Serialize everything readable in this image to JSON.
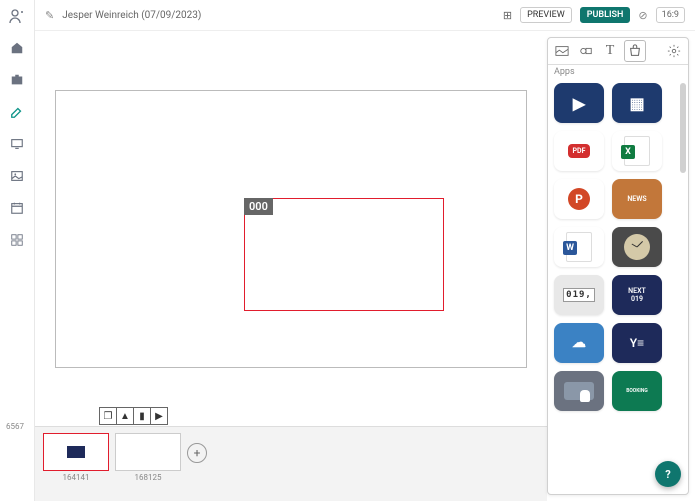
{
  "header": {
    "title": "Jesper Weinreich (07/09/2023)",
    "preview_label": "PREVIEW",
    "publish_label": "PUBLISH",
    "ratio_label": "16:9"
  },
  "canvas": {
    "region_badge": "000"
  },
  "thumb_tools": {
    "layers": "❐",
    "up": "▲",
    "del": "▮",
    "next": "▶"
  },
  "thumbs": [
    {
      "label": "164141",
      "selected": true,
      "mini": true
    },
    {
      "label": "168125",
      "selected": false,
      "mini": false
    }
  ],
  "panel": {
    "section_label": "Apps",
    "tiles": [
      {
        "bg": "#1e3a6e",
        "text": "▶",
        "fs": 16
      },
      {
        "bg": "#1e3a6e",
        "text": "▦",
        "fs": 16
      },
      {
        "bg": "#fff",
        "text": "PDF",
        "fs": 8,
        "fg": "#d32f2f",
        "pill": "#d32f2f"
      },
      {
        "bg": "#fff",
        "text": "X",
        "fs": 14,
        "fg": "#107c41",
        "sheet": true
      },
      {
        "bg": "#fff",
        "text": "P",
        "fs": 14,
        "fg": "#d24726",
        "circ": true
      },
      {
        "bg": "#c2773a",
        "text": "NEWS",
        "fs": 7
      },
      {
        "bg": "#fff",
        "text": "W",
        "fs": 14,
        "fg": "#2b579a",
        "doc": true
      },
      {
        "bg": "#4a4a4a",
        "text": "◔",
        "fs": 16,
        "clock": true
      },
      {
        "bg": "#e8e8e8",
        "text": "019,",
        "fs": 9,
        "fg": "#333",
        "counter": true
      },
      {
        "bg": "#1e2a5a",
        "text": "NEXT\n019",
        "fs": 7
      },
      {
        "bg": "#3b82c4",
        "text": "☁",
        "fs": 14
      },
      {
        "bg": "#1e2a5a",
        "text": "Y≡",
        "fs": 12
      },
      {
        "bg": "#6b7280",
        "text": "☛",
        "fs": 14,
        "touch": true
      },
      {
        "bg": "#0d7a52",
        "text": "BOOKING",
        "fs": 5
      }
    ]
  },
  "counter_label": "6567",
  "help_label": "?"
}
